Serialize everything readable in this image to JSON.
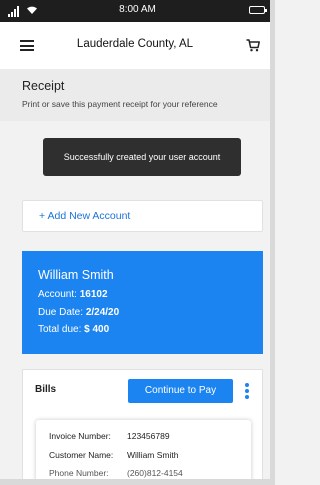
{
  "status_bar": {
    "time": "8:00 AM"
  },
  "header": {
    "title": "Lauderdale County, AL"
  },
  "receipt": {
    "title": "Receipt",
    "subtitle": "Print or save this payment receipt for your reference"
  },
  "toast": {
    "message": "Successfully created your user account"
  },
  "add_account": {
    "label": "+ Add New Account"
  },
  "account": {
    "name": "William Smith",
    "account_label": "Account:",
    "account_number": "16102",
    "due_date_label": "Due Date:",
    "due_date": "2/24/20",
    "total_due_label": "Total due:",
    "total_due": "$ 400"
  },
  "bills": {
    "title": "Bills",
    "pay_button": "Continue to Pay",
    "invoice": {
      "invoice_number_label": "Invoice Number:",
      "invoice_number": "123456789",
      "customer_name_label": "Customer Name:",
      "customer_name": "William Smith",
      "phone_label": "Phone Number:",
      "phone": "(260)812-4154"
    }
  },
  "colors": {
    "accent": "#1c84f0",
    "toast_bg": "#2f2f2f",
    "status_bar": "#1e1e1e"
  }
}
